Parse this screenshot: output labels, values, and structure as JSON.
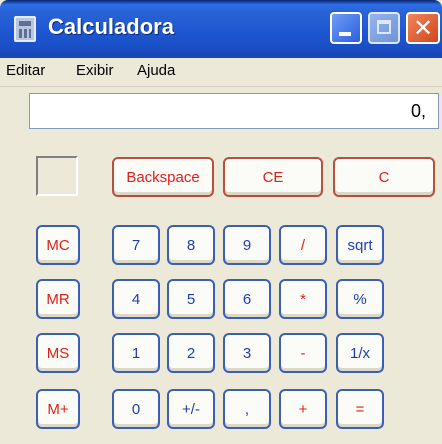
{
  "window": {
    "title": "Calculadora"
  },
  "menu": [
    "Editar",
    "Exibir",
    "Ajuda"
  ],
  "display": {
    "value": "0,"
  },
  "keys": {
    "backspace": "Backspace",
    "ce": "CE",
    "c": "C",
    "mc": "MC",
    "mr": "MR",
    "ms": "MS",
    "mplus": "M+",
    "k7": "7",
    "k8": "8",
    "k9": "9",
    "div": "/",
    "sqrt": "sqrt",
    "k4": "4",
    "k5": "5",
    "k6": "6",
    "mul": "*",
    "pct": "%",
    "k1": "1",
    "k2": "2",
    "k3": "3",
    "sub": "-",
    "inv": "1/x",
    "k0": "0",
    "sign": "+/-",
    "dec": ",",
    "add": "+",
    "eq": "="
  },
  "colors": {
    "red_key": "#e0201a",
    "blue_key": "#1f3fb1",
    "window_bg": "#ECE9D8",
    "titlebar": "#1f57d2"
  },
  "icons": [
    "calculator-icon",
    "minimize-icon",
    "maximize-icon",
    "close-icon"
  ]
}
